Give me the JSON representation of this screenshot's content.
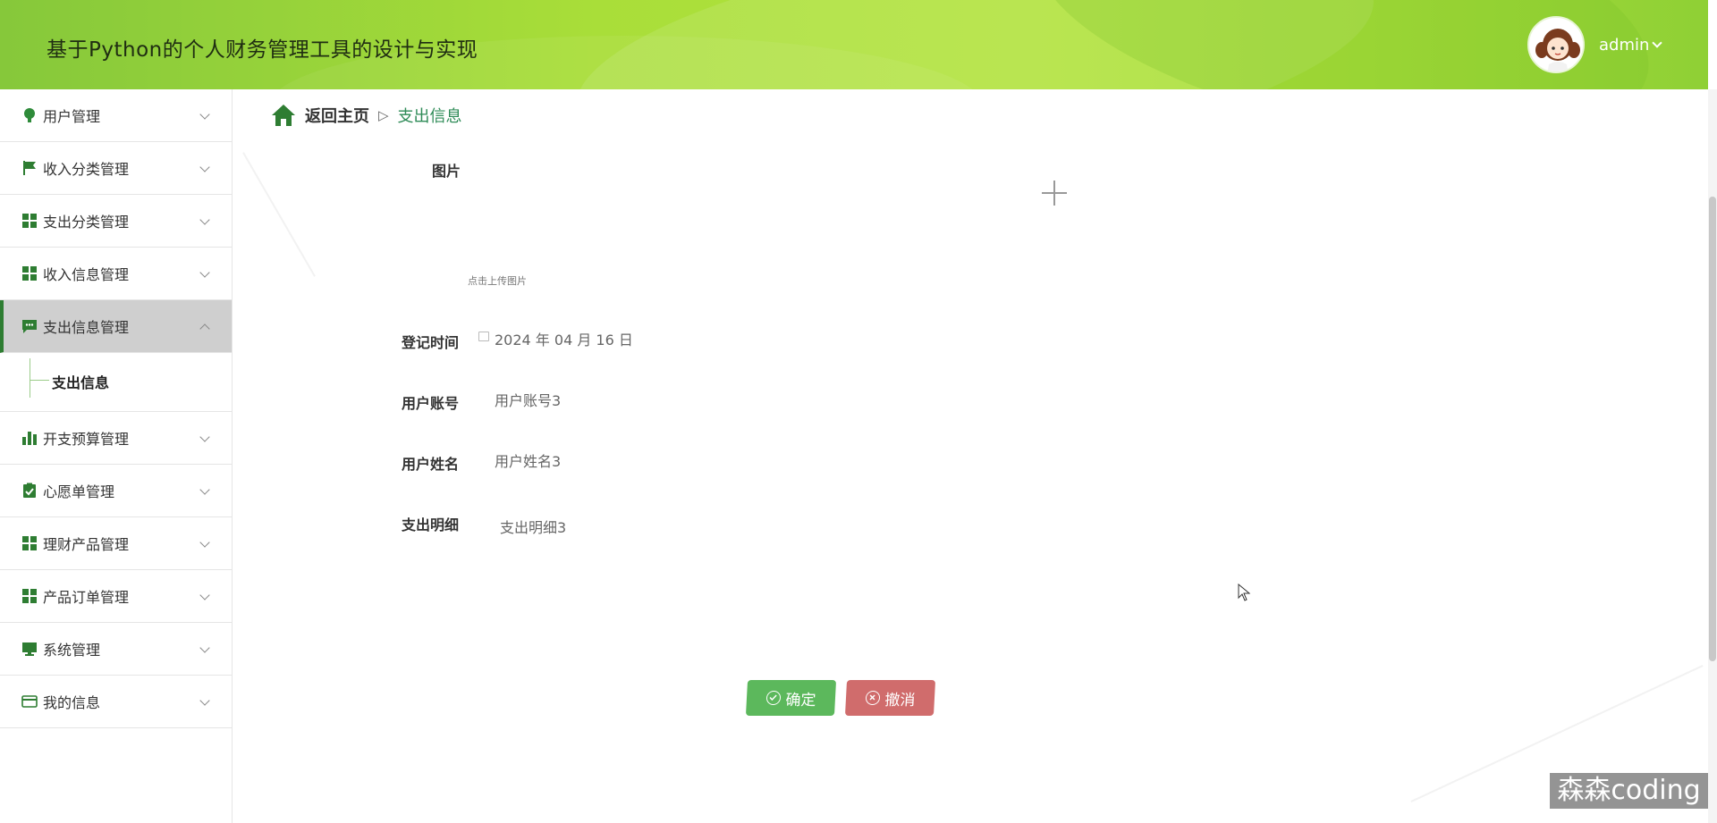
{
  "header": {
    "title": "基于Python的个人财务管理工具的设计与实现",
    "username": "admin"
  },
  "sidebar": {
    "items": [
      {
        "label": "用户管理",
        "icon": "bulb-icon"
      },
      {
        "label": "收入分类管理",
        "icon": "flag-icon"
      },
      {
        "label": "支出分类管理",
        "icon": "grid-icon"
      },
      {
        "label": "收入信息管理",
        "icon": "grid-icon"
      },
      {
        "label": "支出信息管理",
        "icon": "chat-icon",
        "expanded": true
      },
      {
        "label": "开支预算管理",
        "icon": "bar-chart-icon"
      },
      {
        "label": "心愿单管理",
        "icon": "clipboard-check-icon"
      },
      {
        "label": "理财产品管理",
        "icon": "grid-icon"
      },
      {
        "label": "产品订单管理",
        "icon": "grid-icon"
      },
      {
        "label": "系统管理",
        "icon": "monitor-icon"
      },
      {
        "label": "我的信息",
        "icon": "card-icon"
      }
    ],
    "sub_items": {
      "expense_info": "支出信息"
    }
  },
  "breadcrumb": {
    "home": "返回主页",
    "separator": "▷",
    "current": "支出信息"
  },
  "form": {
    "image_label": "图片",
    "upload_hint": "点击上传图片",
    "register_time_label": "登记时间",
    "register_time_value": "2024 年 04 月 16 日",
    "account_label": "用户账号",
    "account_value": "用户账号3",
    "name_label": "用户姓名",
    "name_value": "用户姓名3",
    "detail_label": "支出明细",
    "detail_value": "支出明细3"
  },
  "buttons": {
    "confirm": "确定",
    "cancel": "撤消"
  },
  "watermark": "森森coding",
  "colors": {
    "primary_green": "#2e7d32",
    "confirm": "#5cb85c",
    "cancel": "#d06c6c",
    "header": "#a9de39"
  }
}
